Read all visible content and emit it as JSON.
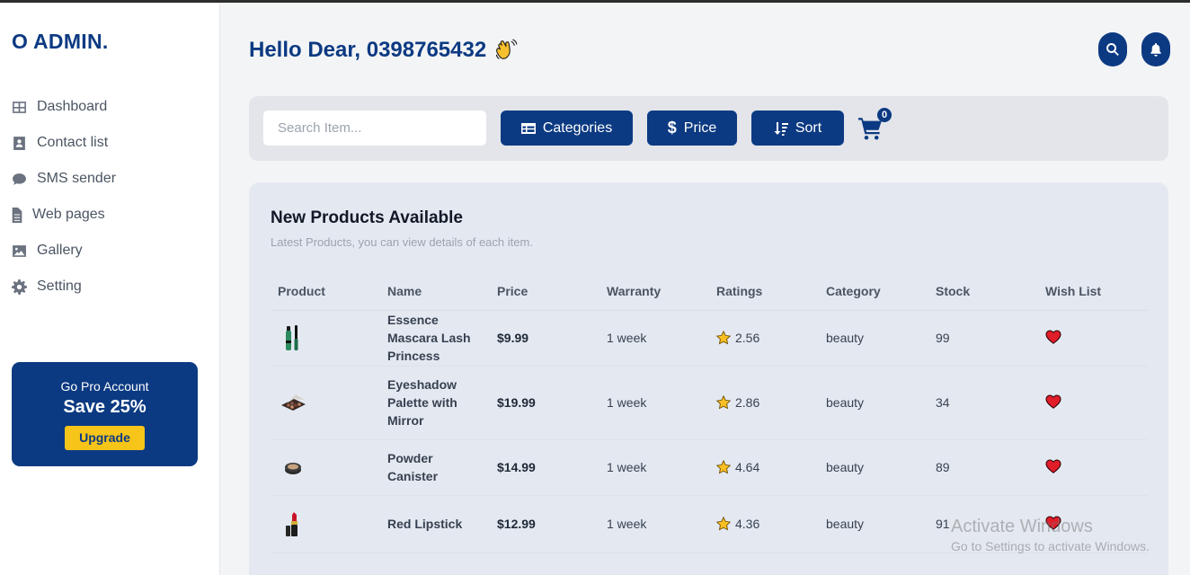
{
  "sidebar": {
    "logo": "O ADMIN.",
    "items": [
      {
        "label": "Dashboard",
        "icon": "grid-icon"
      },
      {
        "label": "Contact list",
        "icon": "contact-icon"
      },
      {
        "label": "SMS sender",
        "icon": "sms-icon"
      },
      {
        "label": "Web pages",
        "icon": "file-icon"
      },
      {
        "label": "Gallery",
        "icon": "image-icon"
      },
      {
        "label": "Setting",
        "icon": "gear-icon"
      }
    ],
    "pro": {
      "title": "Go Pro Account",
      "save": "Save 25%",
      "button": "Upgrade"
    }
  },
  "header": {
    "greeting": "Hello Dear, 0398765432",
    "emoji": "waving-hand"
  },
  "toolbar": {
    "search_placeholder": "Search Item...",
    "categories_label": "Categories",
    "price_label": "Price",
    "sort_label": "Sort",
    "cart_count": "0"
  },
  "products": {
    "title": "New Products Available",
    "subtitle": "Latest Products, you can view details of each item.",
    "columns": [
      "Product",
      "Name",
      "Price",
      "Warranty",
      "Ratings",
      "Category",
      "Stock",
      "Wish List"
    ],
    "rows": [
      {
        "name": "Essence Mascara Lash Princess",
        "price": "$9.99",
        "warranty": "1 week",
        "rating": "2.56",
        "category": "beauty",
        "stock": "99"
      },
      {
        "name": "Eyeshadow Palette with Mirror",
        "price": "$19.99",
        "warranty": "1 week",
        "rating": "2.86",
        "category": "beauty",
        "stock": "34"
      },
      {
        "name": "Powder Canister",
        "price": "$14.99",
        "warranty": "1 week",
        "rating": "4.64",
        "category": "beauty",
        "stock": "89"
      },
      {
        "name": "Red Lipstick",
        "price": "$12.99",
        "warranty": "1 week",
        "rating": "4.36",
        "category": "beauty",
        "stock": "91"
      }
    ]
  },
  "watermark": {
    "line1": "Activate Windows",
    "line2": "Go to Settings to activate Windows."
  },
  "colors": {
    "brand": "#0c3a82",
    "accent": "#f7c419",
    "heart": "#e11d2a"
  }
}
